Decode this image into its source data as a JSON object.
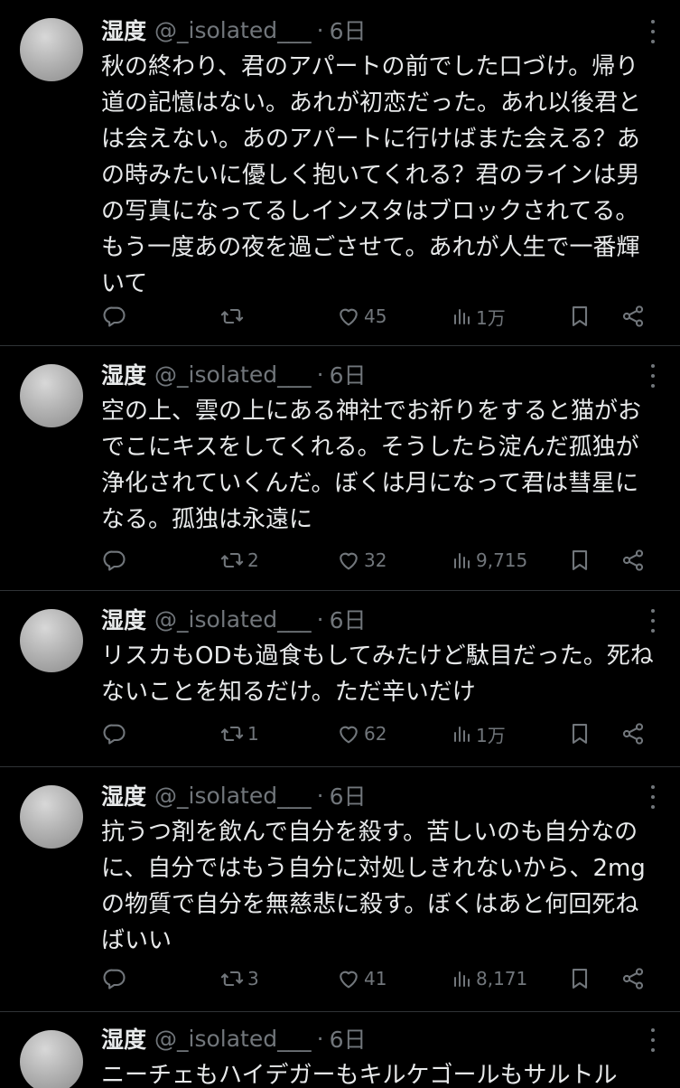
{
  "user": {
    "name": "湿度",
    "handle": "@_isolated___",
    "time": "6日"
  },
  "icons": {
    "reply": "reply-icon",
    "retweet": "retweet-icon",
    "like": "heart-icon",
    "views": "views-icon",
    "bookmark": "bookmark-icon",
    "share": "share-icon",
    "more": "more-icon"
  },
  "colors": {
    "background": "#000000",
    "text": "#e7e9ea",
    "muted": "#71767b",
    "divider": "#2f3336"
  },
  "tweets": [
    {
      "text": "秋の終わり、君のアパートの前でした口づけ。帰り道の記憶はない。あれが初恋だった。あれ以後君とは会えない。あのアパートに行けばまた会える？あの時みたいに優しく抱いてくれる？君のラインは男の写真になってるしインスタはブロックされてる。もう一度あの夜を過ごさせて。あれが人生で一番輝いて",
      "replies": "",
      "retweets": "",
      "likes": "45",
      "views": "1万"
    },
    {
      "text": "空の上、雲の上にある神社でお祈りをすると猫がおでこにキスをしてくれる。そうしたら淀んだ孤独が浄化されていくんだ。ぼくは月になって君は彗星になる。孤独は永遠に",
      "replies": "",
      "retweets": "2",
      "likes": "32",
      "views": "9,715"
    },
    {
      "text": "リスカもODも過食もしてみたけど駄目だった。死ねないことを知るだけ。ただ辛いだけ",
      "replies": "",
      "retweets": "1",
      "likes": "62",
      "views": "1万"
    },
    {
      "text": "抗うつ剤を飲んで自分を殺す。苦しいのも自分なのに、自分ではもう自分に対処しきれないから、2mgの物質で自分を無慈悲に殺す。ぼくはあと何回死ねばいい",
      "replies": "",
      "retweets": "3",
      "likes": "41",
      "views": "8,171"
    },
    {
      "text": "ニーチェもハイデガーもキルケゴールもサルトル"
    }
  ]
}
